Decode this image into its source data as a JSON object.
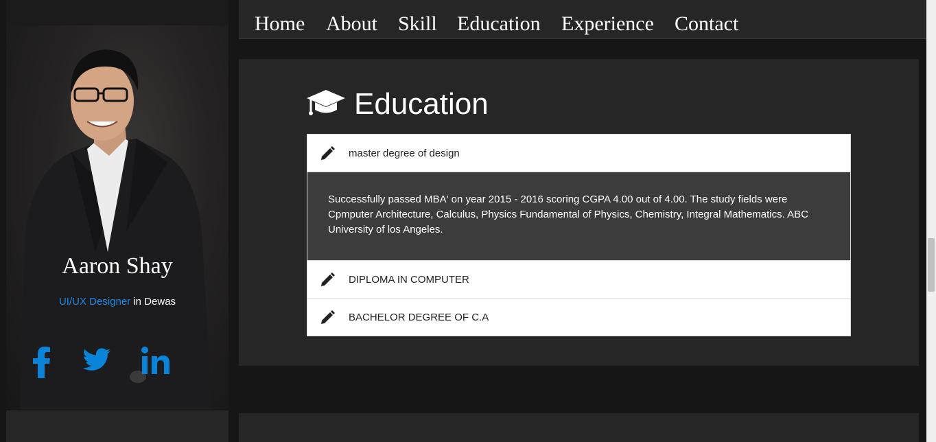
{
  "nav": {
    "items": [
      "Home",
      "About",
      "Skill",
      "Education",
      "Experience",
      "Contact"
    ]
  },
  "profile": {
    "name": "Aaron Shay",
    "role": "UI/UX Designer",
    "location_text": " in Dewas",
    "socials": [
      {
        "icon": "facebook-icon"
      },
      {
        "icon": "twitter-icon"
      },
      {
        "icon": "linkedin-icon"
      }
    ],
    "accent_color": "#1e88e5"
  },
  "education": {
    "title": "Education",
    "items": [
      {
        "label": "master degree of design",
        "expanded": true,
        "body": "Successfully passed MBA' on year 2015 - 2016 scoring CGPA 4.00 out of 4.00. The study fields were Cpmputer Architecture, Calculus, Physics Fundamental of Physics, Chemistry, Integral Mathematics. ABC University of los Angeles."
      },
      {
        "label": "DIPLOMA IN COMPUTER",
        "expanded": false
      },
      {
        "label": "BACHELOR DEGREE OF C.A",
        "expanded": false
      }
    ]
  }
}
